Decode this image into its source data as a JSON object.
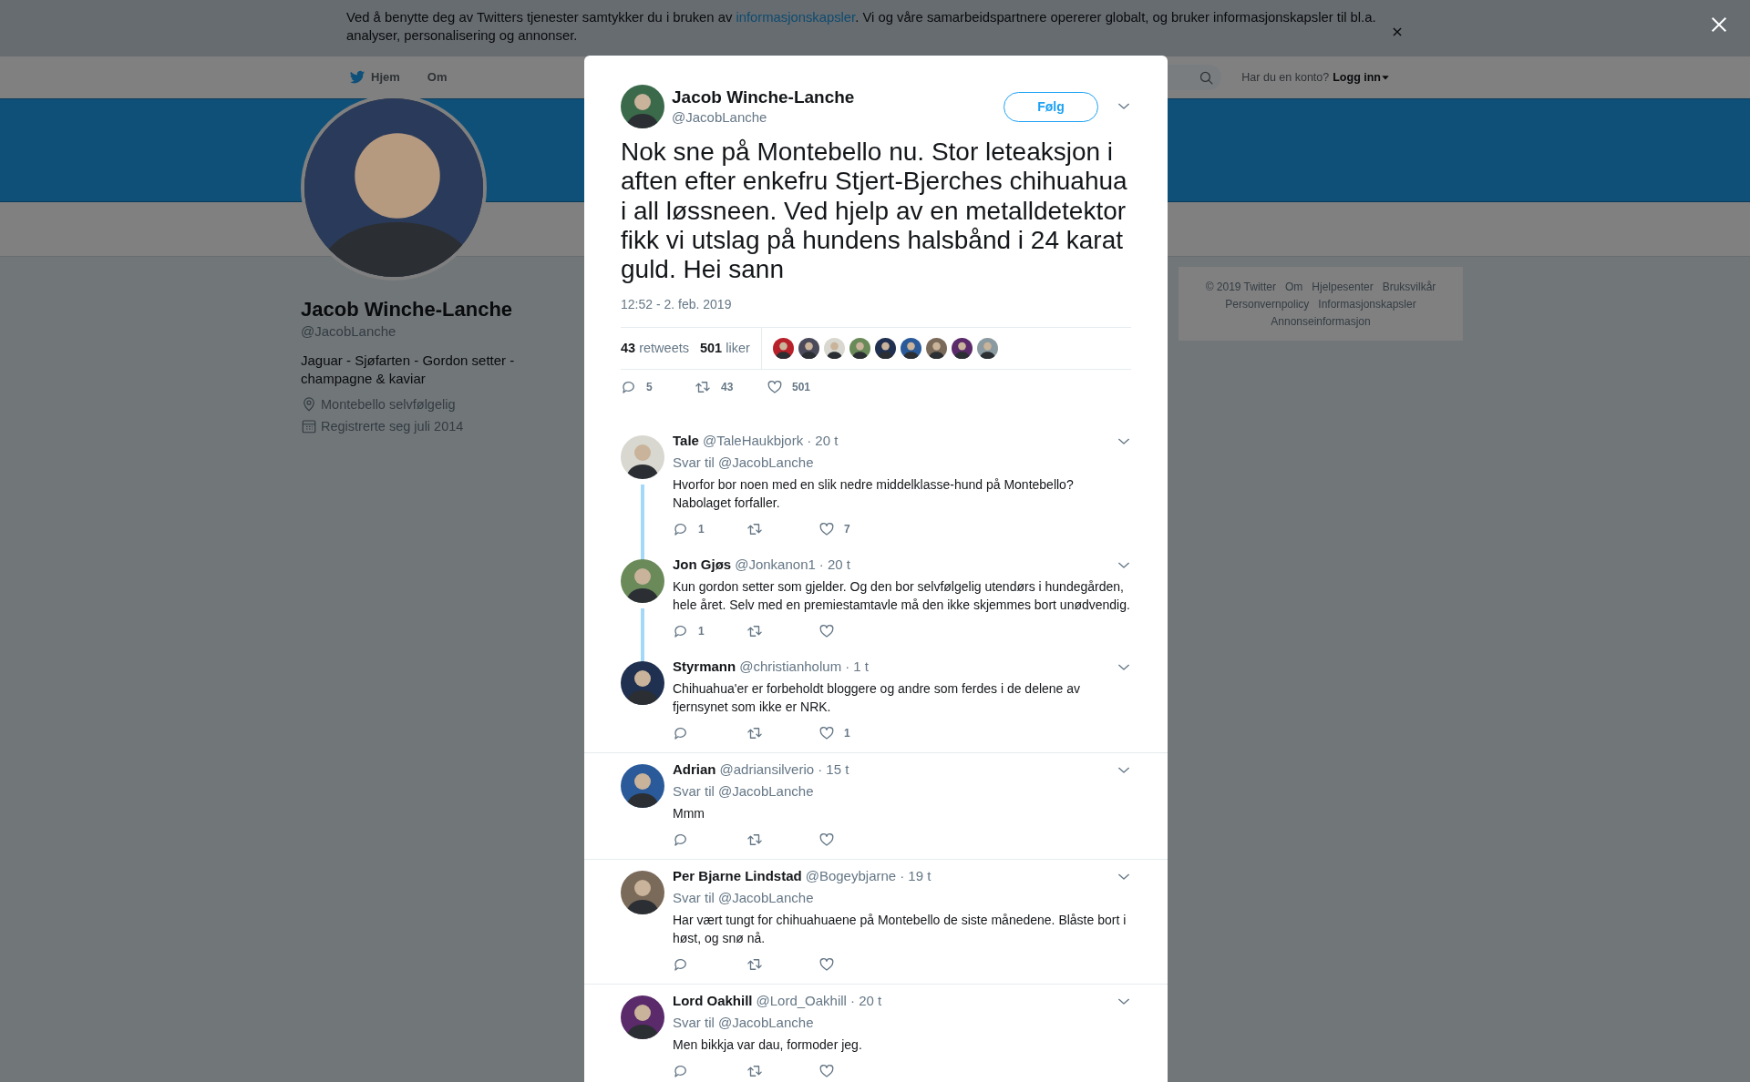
{
  "cookie_banner": {
    "text_before": "Ved å benytte deg av Twitters tjenester samtykker du i bruken av ",
    "link": "informasjonskapsler",
    "text_after": ". Vi og våre samarbeidspartnere opererer globalt, og bruker informasjonskapsler til bl.a. analyser, personalisering og annonser."
  },
  "nav": {
    "items": [
      {
        "label": "Hjem",
        "kind": "home"
      },
      {
        "label": "Om",
        "kind": "plain"
      }
    ]
  },
  "account": {
    "prompt": "Har du en konto?",
    "login": "Logg inn"
  },
  "profile": {
    "name": "Jacob Winche-Lanche",
    "handle": "@JacobLanche",
    "bio": "Jaguar - Sjøfarten - Gordon setter - champagne & kaviar",
    "location": "Montebello selvfølgelig",
    "joined": "Registrerte seg juli 2014"
  },
  "footer_links": [
    "© 2019 Twitter",
    "Om",
    "Hjelpesenter",
    "Bruksvilkår",
    "Personvernpolicy",
    "Informasjonskapsler",
    "Annonseinformasjon"
  ],
  "tweet": {
    "name": "Jacob Winche-Lanche",
    "handle": "@JacobLanche",
    "follow_label": "Følg",
    "text": "Nok sne på Montebello nu. Stor leteaksjon i aften efter enkefru Stjert-Bjerches chihuahua i all løssneen. Ved hjelp av en metalldetektor fikk vi utslag på hundens halsbånd i 24 karat guld. Hei sann",
    "timestamp": "12:52 - 2. feb. 2019",
    "retweets_count": "43",
    "retweets_label": "retweets",
    "likes_count": "501",
    "likes_label": "liker",
    "replies": "5",
    "retweets": "43",
    "likes": "501"
  },
  "replies": [
    {
      "name": "Tale",
      "handle": "@TaleHaukbjork",
      "time": "· 20 t",
      "reply_prefix": "Svar til",
      "reply_to": "@JacobLanche",
      "text": "Hvorfor bor noen med en slik nedre middelklasse-hund på Montebello? Nabolaget forfaller.",
      "replies": "1",
      "likes": "7",
      "threaded": true
    },
    {
      "name": "Jon Gjøs",
      "handle": "@Jonkanon1",
      "time": "· 20 t",
      "text": "Kun gordon setter som gjelder. Og den bor selvfølgelig utendørs i hundegården, hele året. Selv med en premiestamtavle må den ikke skjemmes bort unødvendig.",
      "replies": "1",
      "threaded": true
    },
    {
      "name": "Styrmann",
      "handle": "@christianholum",
      "time": "· 1 t",
      "text": "Chihuahua'er er forbeholdt bloggere og andre som ferdes i de delene av fjernsynet som ikke er NRK.",
      "likes": "1",
      "threaded": false
    },
    {
      "name": "Adrian",
      "handle": "@adriansilverio",
      "time": "· 15 t",
      "reply_prefix": "Svar til",
      "reply_to": "@JacobLanche",
      "text": "Mmm",
      "threaded": false
    },
    {
      "name": "Per Bjarne Lindstad",
      "handle": "@Bogeybjarne",
      "time": "· 19 t",
      "reply_prefix": "Svar til",
      "reply_to": "@JacobLanche",
      "text": "Har vært tungt for chihuahuaene på Montebello de siste månedene. Blåste bort i høst, og snø nå.",
      "threaded": false
    },
    {
      "name": "Lord Oakhill",
      "handle": "@Lord_Oakhill",
      "time": "· 20 t",
      "reply_prefix": "Svar til",
      "reply_to": "@JacobLanche",
      "text": "Men bikkja var dau, formoder jeg.",
      "threaded": false
    }
  ]
}
